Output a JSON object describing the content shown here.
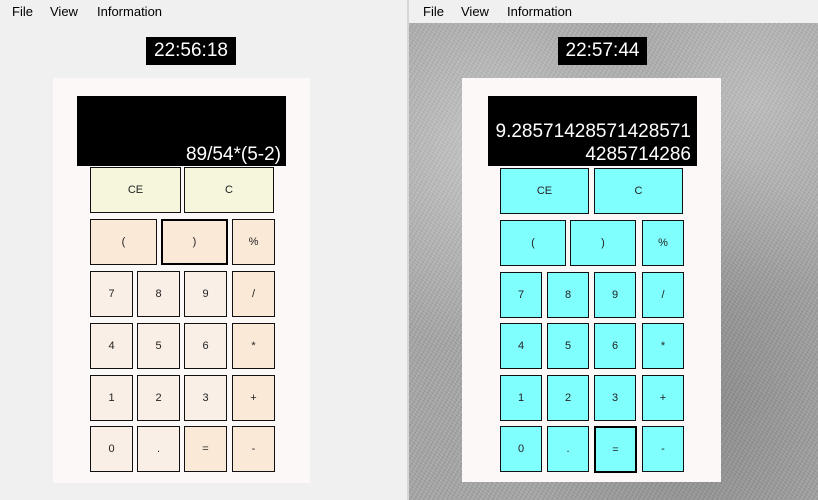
{
  "menu": [
    "File",
    "View",
    "Information"
  ],
  "windows": [
    {
      "clock": "22:56:18",
      "display": "89/54*(5-2)",
      "theme": {
        "top": "#f5f6dc",
        "paren": "#fae9d7",
        "num": "#faefe6",
        "op": "#fae9d7"
      }
    },
    {
      "clock": "22:57:44",
      "display": "9.28571428571428571\n4285714286",
      "theme": {
        "all": "#80ffff"
      }
    }
  ],
  "buttons": {
    "ce": "CE",
    "c": "C",
    "lparen": "(",
    "rparen": ")",
    "percent": "%",
    "n7": "7",
    "n8": "8",
    "n9": "9",
    "div": "/",
    "n4": "4",
    "n5": "5",
    "n6": "6",
    "mul": "*",
    "n1": "1",
    "n2": "2",
    "n3": "3",
    "add": "+",
    "n0": "0",
    "dot": ".",
    "eq": "=",
    "sub": "-"
  }
}
